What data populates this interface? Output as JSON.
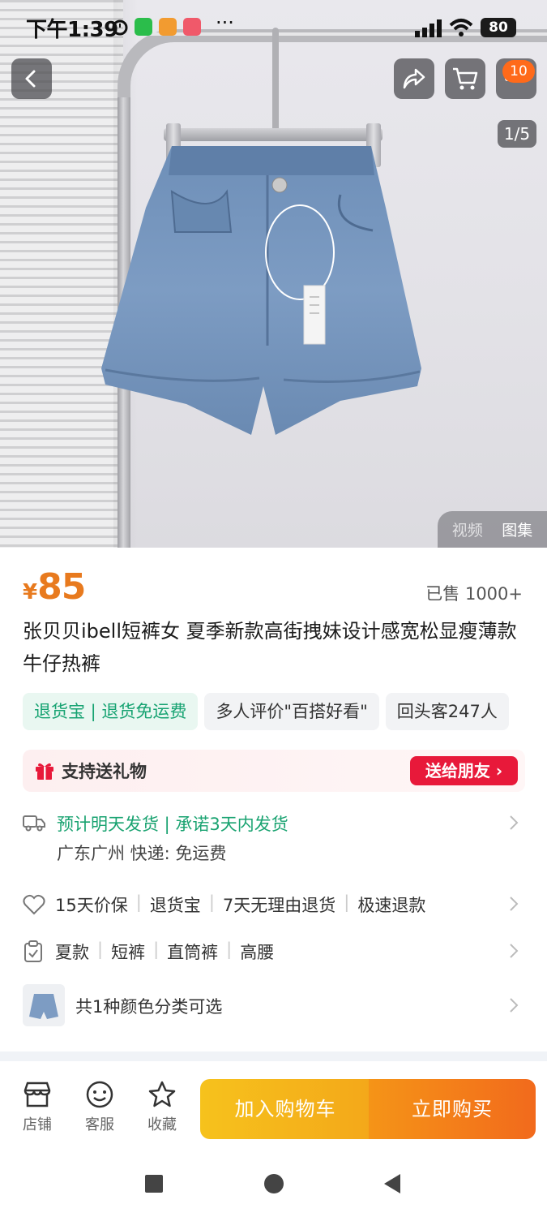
{
  "status_bar": {
    "time": "下午1:39",
    "more": "···",
    "battery": "80"
  },
  "header": {
    "cart_count": "10",
    "page_indicator": "1/5"
  },
  "media_tabs": [
    "视频",
    "图集"
  ],
  "product": {
    "currency": "¥",
    "price": "85",
    "sold": "已售 1000+",
    "title": "张贝贝ibell短裤女 夏季新款高街拽妹设计感宽松显瘦薄款牛仔热裤"
  },
  "tags": [
    "退货宝 | 退货免运费",
    "多人评价\"百搭好看\"",
    "回头客247人"
  ],
  "gift": {
    "label": "支持送礼物",
    "button": "送给朋友 ›"
  },
  "shipping": {
    "line1": "预计明天发货 | 承诺3天内发货",
    "line2": "广东广州 快递: 免运费"
  },
  "services": [
    "15天价保",
    "退货宝",
    "7天无理由退货",
    "极速退款"
  ],
  "attributes": [
    "夏款",
    "短裤",
    "直筒裤",
    "高腰"
  ],
  "color_option": "共1种颜色分类可选",
  "bottom_bar": {
    "store": "店铺",
    "service": "客服",
    "favorite": "收藏",
    "add_to_cart": "加入购物车",
    "buy_now": "立即购买"
  },
  "colors": {
    "price": "#e87a1e",
    "green": "#17a372",
    "buy": "#f26a1c",
    "cart": "#f6c21c",
    "gift_button": "#e8193a"
  }
}
